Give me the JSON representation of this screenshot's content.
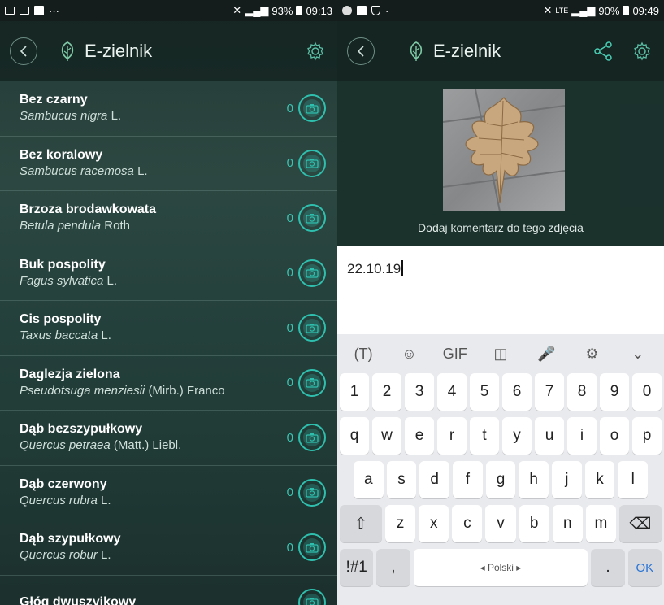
{
  "left": {
    "status": {
      "signal": "93%",
      "time": "09:13",
      "more": "···"
    },
    "app": {
      "title": "E-zielnik"
    },
    "plants": [
      {
        "common": "Bez czarny",
        "latin": "Sambucus nigra",
        "author": "L.",
        "count": "0"
      },
      {
        "common": "Bez koralowy",
        "latin": "Sambucus racemosa",
        "author": "L.",
        "count": "0"
      },
      {
        "common": "Brzoza brodawkowata",
        "latin": "Betula pendula",
        "author": "Roth",
        "count": "0"
      },
      {
        "common": "Buk pospolity",
        "latin": "Fagus sylvatica",
        "author": "L.",
        "count": "0"
      },
      {
        "common": "Cis pospolity",
        "latin": "Taxus baccata",
        "author": "L.",
        "count": "0"
      },
      {
        "common": "Daglezja zielona",
        "latin": "Pseudotsuga menziesii",
        "author": "(Mirb.) Franco",
        "count": "0"
      },
      {
        "common": "Dąb bezszypułkowy",
        "latin": "Quercus petraea",
        "author": "(Matt.) Liebl.",
        "count": "0"
      },
      {
        "common": "Dąb czerwony",
        "latin": "Quercus rubra",
        "author": "L.",
        "count": "0"
      },
      {
        "common": "Dąb szypułkowy",
        "latin": "Quercus robur",
        "author": "L.",
        "count": "0"
      },
      {
        "common": "Głóg dwuszyjkowy",
        "latin": "",
        "author": "",
        "count": ""
      }
    ]
  },
  "right": {
    "status": {
      "network": "LTE",
      "signal": "90%",
      "time": "09:49",
      "dot": "·"
    },
    "app": {
      "title": "E-zielnik"
    },
    "photo_caption": "Dodaj komentarz do tego zdjęcia",
    "comment_value": "22.10.19",
    "keyboard": {
      "toolbar": [
        "(T)",
        "☺",
        "GIF",
        "◫",
        "🎤",
        "⚙",
        "⌄"
      ],
      "row_numbers": [
        "1",
        "2",
        "3",
        "4",
        "5",
        "6",
        "7",
        "8",
        "9",
        "0"
      ],
      "row_q": [
        "q",
        "w",
        "e",
        "r",
        "t",
        "y",
        "u",
        "i",
        "o",
        "p"
      ],
      "row_a": [
        "a",
        "s",
        "d",
        "f",
        "g",
        "h",
        "j",
        "k",
        "l"
      ],
      "row_z": [
        "z",
        "x",
        "c",
        "v",
        "b",
        "n",
        "m"
      ],
      "shift": "⇧",
      "backspace": "⌫",
      "sym": "!#1",
      "comma": ",",
      "space": "◂ Polski ▸",
      "period": ".",
      "ok": "OK"
    }
  },
  "colors": {
    "accent": "#2fbfae",
    "background": "#243834"
  },
  "icons": [
    "back-arrow-icon",
    "leaf-logo-icon",
    "gear-icon",
    "share-icon",
    "camera-icon",
    "shift-icon",
    "backspace-icon"
  ]
}
